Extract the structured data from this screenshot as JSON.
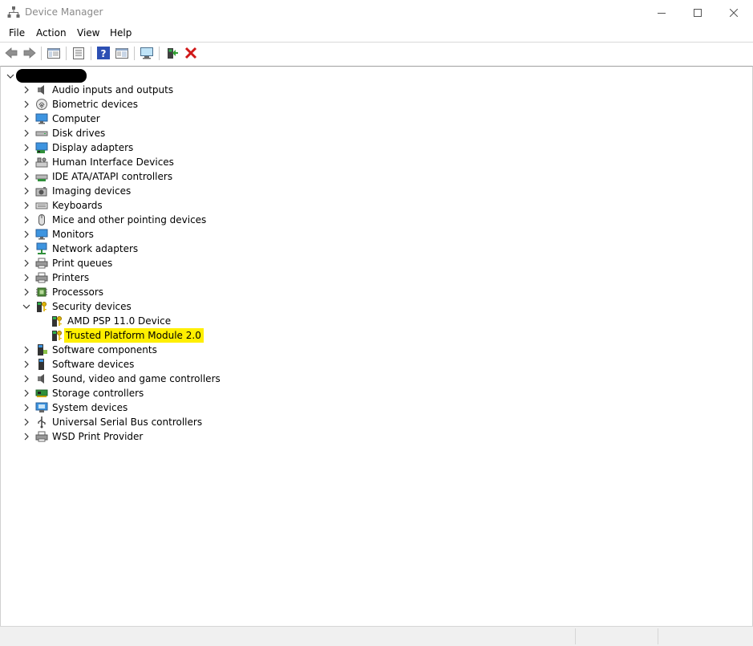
{
  "window": {
    "title": "Device Manager"
  },
  "menu": [
    "File",
    "Action",
    "View",
    "Help"
  ],
  "toolbar": {
    "buttons": [
      "back-icon",
      "forward-icon",
      "show-hide-console-tree-icon",
      "properties-icon",
      "help-icon",
      "update-driver-icon",
      "scan-hardware-icon",
      "enable-device-icon",
      "uninstall-device-icon"
    ]
  },
  "tree": {
    "categories": [
      {
        "label": "Audio inputs and outputs",
        "icon": "speaker-icon"
      },
      {
        "label": "Biometric devices",
        "icon": "fingerprint-icon"
      },
      {
        "label": "Computer",
        "icon": "computer-icon"
      },
      {
        "label": "Disk drives",
        "icon": "disk-drive-icon"
      },
      {
        "label": "Display adapters",
        "icon": "display-adapter-icon"
      },
      {
        "label": "Human Interface Devices",
        "icon": "hid-icon"
      },
      {
        "label": "IDE ATA/ATAPI controllers",
        "icon": "ide-controller-icon"
      },
      {
        "label": "Imaging devices",
        "icon": "camera-icon"
      },
      {
        "label": "Keyboards",
        "icon": "keyboard-icon"
      },
      {
        "label": "Mice and other pointing devices",
        "icon": "mouse-icon"
      },
      {
        "label": "Monitors",
        "icon": "monitor-icon"
      },
      {
        "label": "Network adapters",
        "icon": "network-adapter-icon"
      },
      {
        "label": "Print queues",
        "icon": "printer-icon"
      },
      {
        "label": "Printers",
        "icon": "printer-icon"
      },
      {
        "label": "Processors",
        "icon": "processor-icon"
      },
      {
        "label": "Security devices",
        "icon": "security-key-icon"
      },
      {
        "label": "Software components",
        "icon": "software-component-icon"
      },
      {
        "label": "Software devices",
        "icon": "software-device-icon"
      },
      {
        "label": "Sound, video and game controllers",
        "icon": "speaker-icon"
      },
      {
        "label": "Storage controllers",
        "icon": "storage-controller-icon"
      },
      {
        "label": "System devices",
        "icon": "system-device-icon"
      },
      {
        "label": "Universal Serial Bus controllers",
        "icon": "usb-icon"
      },
      {
        "label": "WSD Print Provider",
        "icon": "printer-icon"
      }
    ],
    "security_children": [
      {
        "label": "AMD PSP 11.0 Device",
        "icon": "security-key-icon"
      },
      {
        "label": "Trusted Platform Module 2.0",
        "icon": "security-key-icon"
      }
    ],
    "highlight_color": "#ffef00"
  }
}
